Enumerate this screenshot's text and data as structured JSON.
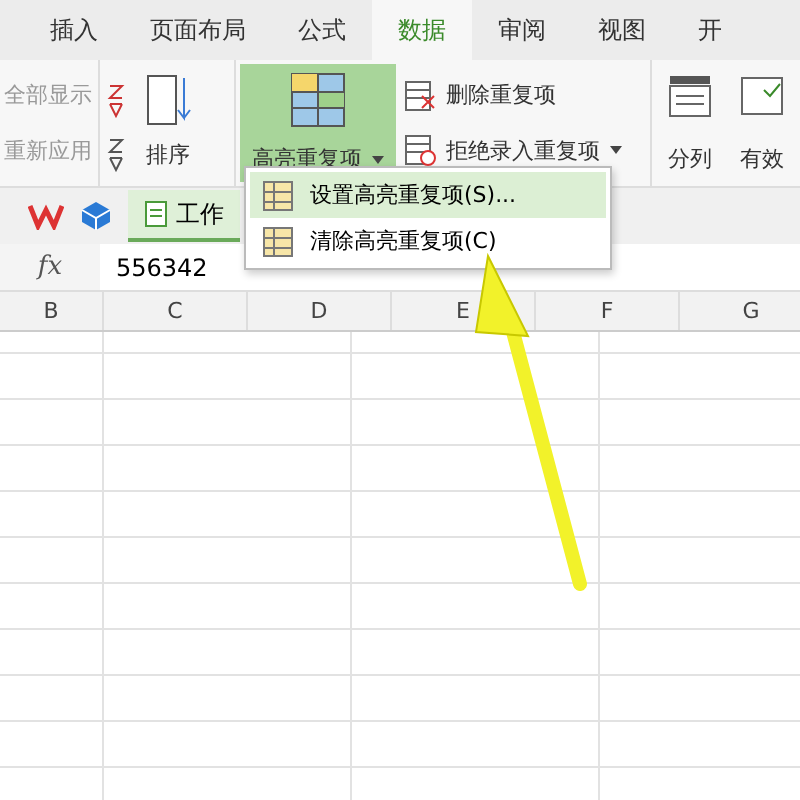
{
  "tabs": [
    {
      "label": "插入",
      "selected": false
    },
    {
      "label": "页面布局",
      "selected": false
    },
    {
      "label": "公式",
      "selected": false
    },
    {
      "label": "数据",
      "selected": true
    },
    {
      "label": "审阅",
      "selected": false
    },
    {
      "label": "视图",
      "selected": false
    },
    {
      "label": "开",
      "selected": false
    }
  ],
  "ribbon": {
    "filter_items": [
      "全部显示",
      "重新应用"
    ],
    "sort_label": "排序",
    "highlight_button": {
      "label": "高亮重复项",
      "active": true
    },
    "duplicate_items": [
      "删除重复项",
      "拒绝录入重复项"
    ],
    "split_label": "分列",
    "validity_label": "有效"
  },
  "quick_bar": {
    "document_tab": "工作"
  },
  "formula_bar": {
    "label": "fx",
    "value": "556342"
  },
  "columns": [
    "B",
    "C",
    "D",
    "E",
    "F",
    "G"
  ],
  "menu": {
    "items": [
      {
        "label": "设置高亮重复项(S)...",
        "selected": true
      },
      {
        "label": "清除高亮重复项(C)",
        "selected": false
      }
    ]
  }
}
